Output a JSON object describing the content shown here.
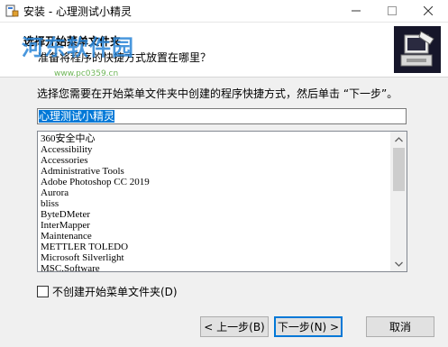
{
  "window": {
    "title": "安装 - 心理测试小精灵",
    "controls": {
      "minimize": "—",
      "maximize": "☐",
      "close": "✕"
    }
  },
  "header": {
    "title": "选择开始菜单文件夹",
    "subtitle": "准备将程序的快捷方式放置在哪里？",
    "watermark": "河东软件园",
    "watermark_url": "www.pc0359.cn"
  },
  "main": {
    "instruction": "选择您需要在开始菜单文件夹中创建的程序快捷方式，然后单击 “下一步”。",
    "folder_name": "心理测试小精灵",
    "folder_list": [
      "360安全中心",
      "Accessibility",
      "Accessories",
      "Administrative Tools",
      "Adobe Photoshop CC 2019",
      "Aurora",
      "bliss",
      "ByteDMeter",
      "InterMapper",
      "Maintenance",
      "METTLER TOLEDO",
      "Microsoft Silverlight",
      "MSC.Software"
    ],
    "no_folder_checkbox": {
      "label": "不创建开始菜单文件夹(D)",
      "checked": false
    }
  },
  "buttons": {
    "back": "< 上一步(B)",
    "next": "下一步(N) >",
    "cancel": "取消"
  },
  "colors": {
    "selection": "#0078d7",
    "watermark": "#2a86d8"
  }
}
